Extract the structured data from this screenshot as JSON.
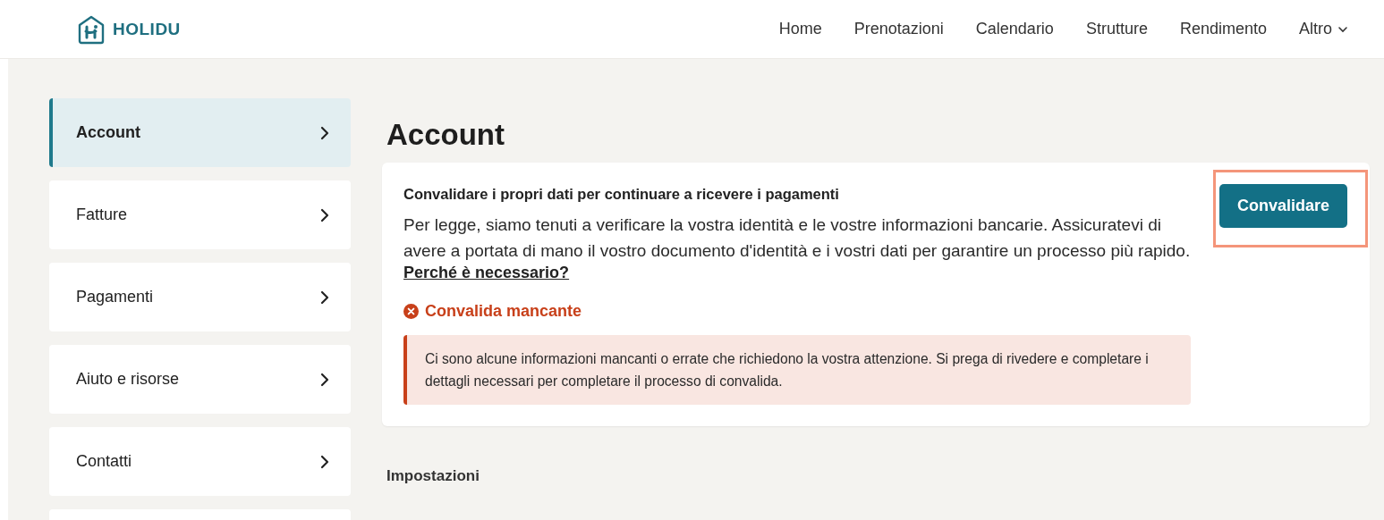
{
  "header": {
    "logo": "HOLIDU",
    "nav": [
      {
        "label": "Home",
        "dropdown": false
      },
      {
        "label": "Prenotazioni",
        "dropdown": false
      },
      {
        "label": "Calendario",
        "dropdown": false
      },
      {
        "label": "Strutture",
        "dropdown": false
      },
      {
        "label": "Rendimento",
        "dropdown": false
      },
      {
        "label": "Altro",
        "dropdown": true
      }
    ]
  },
  "sidebar": {
    "items": [
      {
        "label": "Account",
        "selected": true
      },
      {
        "label": "Fatture",
        "selected": false
      },
      {
        "label": "Pagamenti",
        "selected": false
      },
      {
        "label": "Aiuto e risorse",
        "selected": false
      },
      {
        "label": "Contatti",
        "selected": false
      }
    ]
  },
  "main": {
    "title": "Account",
    "verification": {
      "heading": "Convalidare i propri dati per continuare a ricevere i pagamenti",
      "body": "Per legge, siamo tenuti a verificare la vostra identità e le vostre informazioni bancarie. Assicuratevi di avere a portata di mano il vostro documento d'identità e i vostri dati per garantire un processo più rapido.",
      "link": "Perché è necessario?",
      "button": {
        "label": "Convalidare",
        "highlighted": true
      },
      "status": {
        "label": "Convalida mancante",
        "kind": "error"
      },
      "alert": "Ci sono alcune informazioni mancanti o errate che richiedono la vostra attenzione. Si prega di rivedere e completare i dettagli necessari per completare il processo di convalida."
    },
    "section_title": "Impostazioni"
  }
}
